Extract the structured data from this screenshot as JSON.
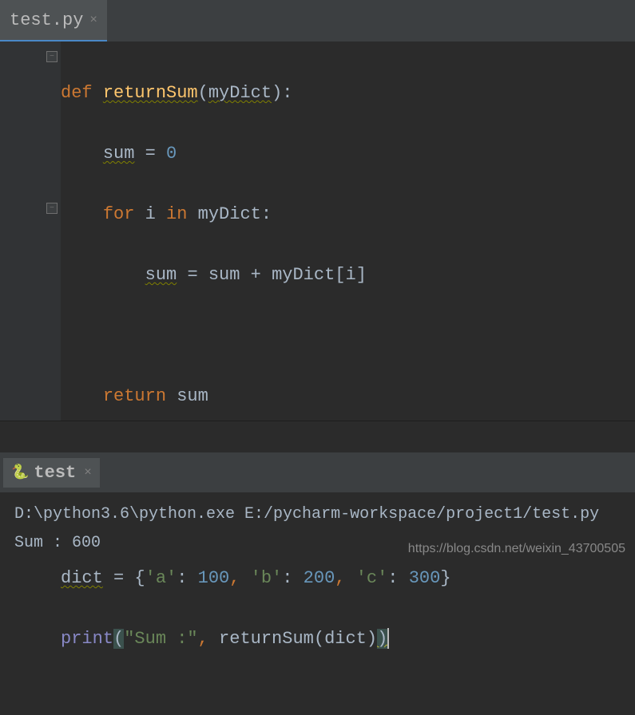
{
  "tab": {
    "filename": "test.py"
  },
  "code": {
    "line1": {
      "def": "def",
      "fn": "returnSum",
      "lp": "(",
      "param": "myDict",
      "rp": ")",
      "colon": ":"
    },
    "line2": {
      "indent": "    ",
      "sum": "sum",
      "sp1": " ",
      "eq": "=",
      "sp2": " ",
      "zero": "0"
    },
    "line3": {
      "indent": "    ",
      "for": "for",
      "sp1": " ",
      "i": "i",
      "sp2": " ",
      "in": "in",
      "sp3": " ",
      "myDict": "myDict",
      "colon": ":"
    },
    "line4": {
      "indent": "        ",
      "sum1": "sum",
      "sp1": " ",
      "eq": "=",
      "sp2": " ",
      "sum2": "sum",
      "sp3": " ",
      "plus": "+",
      "sp4": " ",
      "myDict": "myDict",
      "lb": "[",
      "i": "i",
      "rb": "]"
    },
    "line6": {
      "indent": "    ",
      "return": "return",
      "sp": " ",
      "sum": "sum"
    },
    "line9": {
      "dict": "dict",
      "sp1": " ",
      "eq": "=",
      "sp2": " ",
      "lb": "{",
      "ka": "'a'",
      "c1": ":",
      "sp3": " ",
      "va": "100",
      "cm1": ",",
      "sp4": " ",
      "kb": "'b'",
      "c2": ":",
      "sp5": " ",
      "vb": "200",
      "cm2": ",",
      "sp6": " ",
      "kc": "'c'",
      "c3": ":",
      "sp7": " ",
      "vc": "300",
      "rb": "}"
    },
    "line10": {
      "print": "print",
      "lp": "(",
      "str": "\"Sum :\"",
      "cm": ",",
      "sp": " ",
      "fn": "returnSum",
      "lp2": "(",
      "arg": "dict",
      "rp2": ")",
      "rp": ")"
    }
  },
  "console": {
    "tab_label": "test",
    "line1": "D:\\python3.6\\python.exe E:/pycharm-workspace/project1/test.py",
    "line2": "Sum : 600"
  },
  "watermark": "https://blog.csdn.net/weixin_43700505"
}
